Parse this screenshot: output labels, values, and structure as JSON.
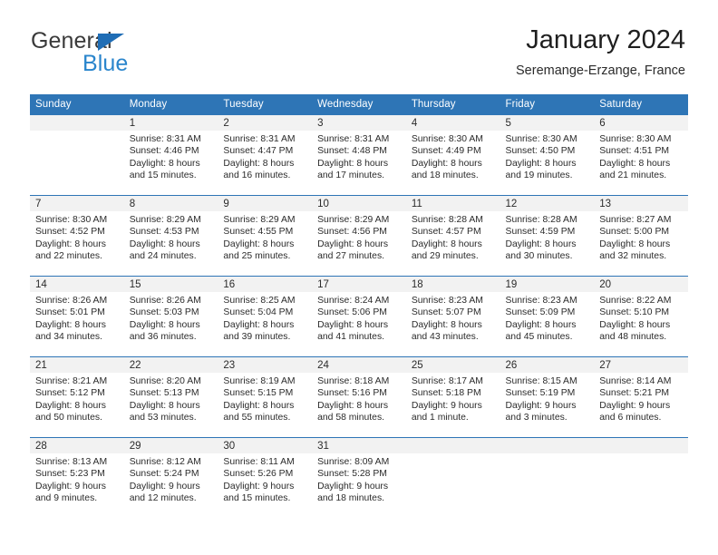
{
  "brand": {
    "name_part1": "General",
    "name_part2": "Blue",
    "triangle_icon": "triangle-icon",
    "accent_color": "#2a85cc",
    "triangle_color": "#1f6db5"
  },
  "header": {
    "title": "January 2024",
    "subtitle": "Seremange-Erzange, France"
  },
  "calendar": {
    "header_bg": "#2e75b6",
    "daynum_bg": "#f2f2f2",
    "weekday_headers": [
      "Sunday",
      "Monday",
      "Tuesday",
      "Wednesday",
      "Thursday",
      "Friday",
      "Saturday"
    ],
    "weeks": [
      [
        {
          "day": "",
          "lines": []
        },
        {
          "day": "1",
          "lines": [
            "Sunrise: 8:31 AM",
            "Sunset: 4:46 PM",
            "Daylight: 8 hours",
            "and 15 minutes."
          ]
        },
        {
          "day": "2",
          "lines": [
            "Sunrise: 8:31 AM",
            "Sunset: 4:47 PM",
            "Daylight: 8 hours",
            "and 16 minutes."
          ]
        },
        {
          "day": "3",
          "lines": [
            "Sunrise: 8:31 AM",
            "Sunset: 4:48 PM",
            "Daylight: 8 hours",
            "and 17 minutes."
          ]
        },
        {
          "day": "4",
          "lines": [
            "Sunrise: 8:30 AM",
            "Sunset: 4:49 PM",
            "Daylight: 8 hours",
            "and 18 minutes."
          ]
        },
        {
          "day": "5",
          "lines": [
            "Sunrise: 8:30 AM",
            "Sunset: 4:50 PM",
            "Daylight: 8 hours",
            "and 19 minutes."
          ]
        },
        {
          "day": "6",
          "lines": [
            "Sunrise: 8:30 AM",
            "Sunset: 4:51 PM",
            "Daylight: 8 hours",
            "and 21 minutes."
          ]
        }
      ],
      [
        {
          "day": "7",
          "lines": [
            "Sunrise: 8:30 AM",
            "Sunset: 4:52 PM",
            "Daylight: 8 hours",
            "and 22 minutes."
          ]
        },
        {
          "day": "8",
          "lines": [
            "Sunrise: 8:29 AM",
            "Sunset: 4:53 PM",
            "Daylight: 8 hours",
            "and 24 minutes."
          ]
        },
        {
          "day": "9",
          "lines": [
            "Sunrise: 8:29 AM",
            "Sunset: 4:55 PM",
            "Daylight: 8 hours",
            "and 25 minutes."
          ]
        },
        {
          "day": "10",
          "lines": [
            "Sunrise: 8:29 AM",
            "Sunset: 4:56 PM",
            "Daylight: 8 hours",
            "and 27 minutes."
          ]
        },
        {
          "day": "11",
          "lines": [
            "Sunrise: 8:28 AM",
            "Sunset: 4:57 PM",
            "Daylight: 8 hours",
            "and 29 minutes."
          ]
        },
        {
          "day": "12",
          "lines": [
            "Sunrise: 8:28 AM",
            "Sunset: 4:59 PM",
            "Daylight: 8 hours",
            "and 30 minutes."
          ]
        },
        {
          "day": "13",
          "lines": [
            "Sunrise: 8:27 AM",
            "Sunset: 5:00 PM",
            "Daylight: 8 hours",
            "and 32 minutes."
          ]
        }
      ],
      [
        {
          "day": "14",
          "lines": [
            "Sunrise: 8:26 AM",
            "Sunset: 5:01 PM",
            "Daylight: 8 hours",
            "and 34 minutes."
          ]
        },
        {
          "day": "15",
          "lines": [
            "Sunrise: 8:26 AM",
            "Sunset: 5:03 PM",
            "Daylight: 8 hours",
            "and 36 minutes."
          ]
        },
        {
          "day": "16",
          "lines": [
            "Sunrise: 8:25 AM",
            "Sunset: 5:04 PM",
            "Daylight: 8 hours",
            "and 39 minutes."
          ]
        },
        {
          "day": "17",
          "lines": [
            "Sunrise: 8:24 AM",
            "Sunset: 5:06 PM",
            "Daylight: 8 hours",
            "and 41 minutes."
          ]
        },
        {
          "day": "18",
          "lines": [
            "Sunrise: 8:23 AM",
            "Sunset: 5:07 PM",
            "Daylight: 8 hours",
            "and 43 minutes."
          ]
        },
        {
          "day": "19",
          "lines": [
            "Sunrise: 8:23 AM",
            "Sunset: 5:09 PM",
            "Daylight: 8 hours",
            "and 45 minutes."
          ]
        },
        {
          "day": "20",
          "lines": [
            "Sunrise: 8:22 AM",
            "Sunset: 5:10 PM",
            "Daylight: 8 hours",
            "and 48 minutes."
          ]
        }
      ],
      [
        {
          "day": "21",
          "lines": [
            "Sunrise: 8:21 AM",
            "Sunset: 5:12 PM",
            "Daylight: 8 hours",
            "and 50 minutes."
          ]
        },
        {
          "day": "22",
          "lines": [
            "Sunrise: 8:20 AM",
            "Sunset: 5:13 PM",
            "Daylight: 8 hours",
            "and 53 minutes."
          ]
        },
        {
          "day": "23",
          "lines": [
            "Sunrise: 8:19 AM",
            "Sunset: 5:15 PM",
            "Daylight: 8 hours",
            "and 55 minutes."
          ]
        },
        {
          "day": "24",
          "lines": [
            "Sunrise: 8:18 AM",
            "Sunset: 5:16 PM",
            "Daylight: 8 hours",
            "and 58 minutes."
          ]
        },
        {
          "day": "25",
          "lines": [
            "Sunrise: 8:17 AM",
            "Sunset: 5:18 PM",
            "Daylight: 9 hours",
            "and 1 minute."
          ]
        },
        {
          "day": "26",
          "lines": [
            "Sunrise: 8:15 AM",
            "Sunset: 5:19 PM",
            "Daylight: 9 hours",
            "and 3 minutes."
          ]
        },
        {
          "day": "27",
          "lines": [
            "Sunrise: 8:14 AM",
            "Sunset: 5:21 PM",
            "Daylight: 9 hours",
            "and 6 minutes."
          ]
        }
      ],
      [
        {
          "day": "28",
          "lines": [
            "Sunrise: 8:13 AM",
            "Sunset: 5:23 PM",
            "Daylight: 9 hours",
            "and 9 minutes."
          ]
        },
        {
          "day": "29",
          "lines": [
            "Sunrise: 8:12 AM",
            "Sunset: 5:24 PM",
            "Daylight: 9 hours",
            "and 12 minutes."
          ]
        },
        {
          "day": "30",
          "lines": [
            "Sunrise: 8:11 AM",
            "Sunset: 5:26 PM",
            "Daylight: 9 hours",
            "and 15 minutes."
          ]
        },
        {
          "day": "31",
          "lines": [
            "Sunrise: 8:09 AM",
            "Sunset: 5:28 PM",
            "Daylight: 9 hours",
            "and 18 minutes."
          ]
        },
        {
          "day": "",
          "lines": []
        },
        {
          "day": "",
          "lines": []
        },
        {
          "day": "",
          "lines": []
        }
      ]
    ]
  }
}
